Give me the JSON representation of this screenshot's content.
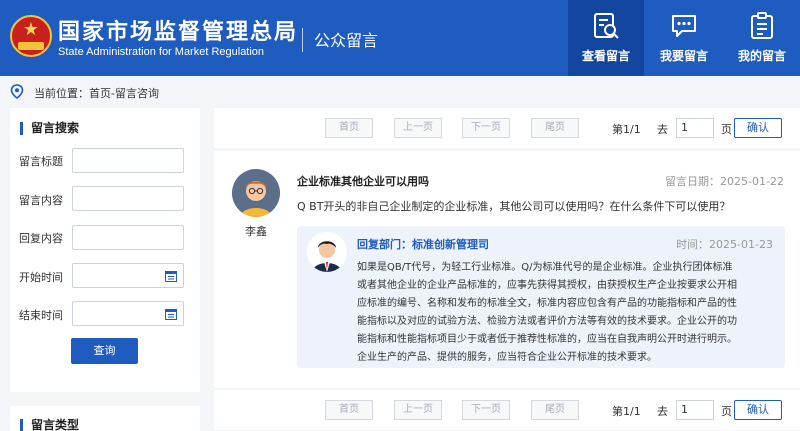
{
  "header": {
    "title_cn": "国家市场监督管理总局",
    "title_en": "State Administration for Market Regulation",
    "section": "公众留言",
    "nav": [
      {
        "label": "查看留言",
        "icon": "search-document-icon",
        "active": true
      },
      {
        "label": "我要留言",
        "icon": "chat-bubble-icon",
        "active": false
      },
      {
        "label": "我的留言",
        "icon": "clipboard-list-icon",
        "active": false
      }
    ]
  },
  "breadcrumb": {
    "text": "当前位置：首页-留言咨询",
    "icon": "location-pin-icon"
  },
  "sidebar": {
    "search_title": "留言搜索",
    "fields": [
      {
        "label": "留言标题",
        "value": ""
      },
      {
        "label": "留言内容",
        "value": ""
      },
      {
        "label": "回复内容",
        "value": ""
      },
      {
        "label": "开始时间",
        "value": "",
        "icon": "calendar-icon"
      },
      {
        "label": "结束时间",
        "value": "",
        "icon": "calendar-icon"
      }
    ],
    "query_label": "查询",
    "type_title": "留言类型"
  },
  "pager": {
    "first": "首页",
    "prev": "上一页",
    "next": "下一页",
    "last": "尾页",
    "info": "第1/1",
    "goto": "去",
    "page_value": "1",
    "page_unit": "页",
    "confirm": "确认"
  },
  "message": {
    "user": "李鑫",
    "title": "企业标准其他企业可以用吗",
    "date": "留言日期：2025-01-22",
    "question": "Q BT开头的非自己企业制定的企业标准，其他公司可以使用吗？在什么条件下可以使用？",
    "reply": {
      "dept": "回复部门：标准创新管理司",
      "date": "时间：2025-01-23",
      "lines": [
        "如果是QB/T代号，为轻工行业标准。Q/为标准代号的是企业标准。企业执行团体标准",
        "或者其他企业的企业产品标准的，应事先获得其授权，由获授权生产企业按要求公开相",
        "应标准的编号、名称和发布的标准全文，标准内容应包含有产品的功能指标和产品的性",
        "能指标以及对应的试验方法、检验方法或者评价方法等有效的技术要求。企业公开的功",
        "能指标和性能指标项目少于或者低于推荐性标准的，应当在自我声明公开时进行明示。",
        "企业生产的产品、提供的服务，应当符合企业公开标准的技术要求。"
      ]
    }
  },
  "colors": {
    "brand": "#1f5cc0",
    "brand_dark": "#13479f",
    "background": "#f3f5f8",
    "reply_bg": "#eef3fb"
  }
}
